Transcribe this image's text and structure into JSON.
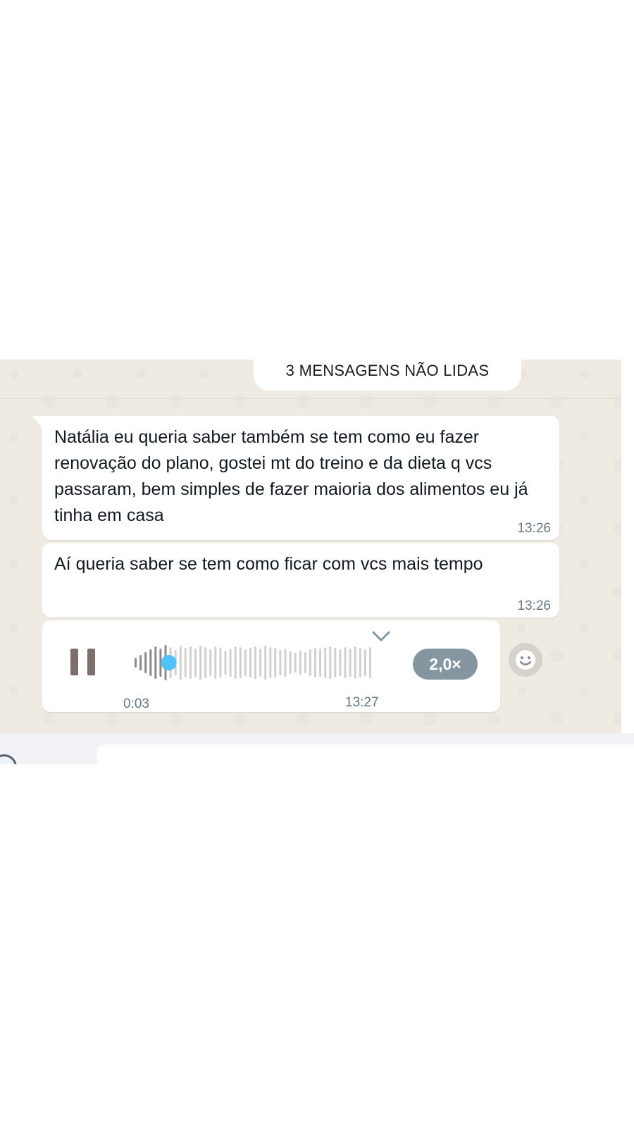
{
  "unread_banner": {
    "label": "3 MENSAGENS NÃO LIDAS"
  },
  "messages": [
    {
      "text": "Natália eu queria saber também se tem como eu fazer renovação do plano, gostei mt do treino e da dieta q vcs passaram, bem simples de fazer maioria dos alimentos eu já tinha em casa",
      "time": "13:26"
    },
    {
      "text": "Aí queria saber se tem como ficar com vcs mais tempo",
      "time": "13:26"
    }
  ],
  "voice_message": {
    "elapsed": "0:03",
    "time": "13:27",
    "speed": "2,0×",
    "progress": 0.14,
    "state_icon": "pause-icon",
    "colors": {
      "played": "#8a8a8a",
      "unplayed": "#d0d0d0",
      "handle": "#4fc3f7"
    }
  },
  "icons": {
    "reaction": "emoji-icon",
    "download": "chevron-down-icon",
    "attach": "plus-icon"
  }
}
